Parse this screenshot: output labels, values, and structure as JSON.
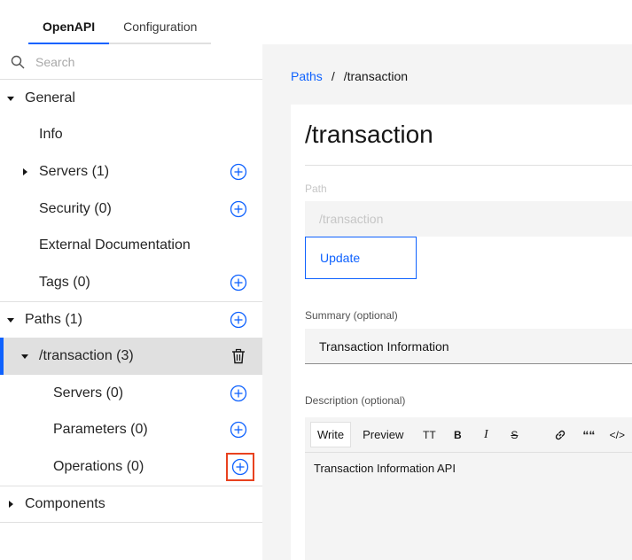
{
  "tabs": [
    {
      "label": "OpenAPI",
      "active": true
    },
    {
      "label": "Configuration",
      "active": false
    }
  ],
  "search": {
    "placeholder": "Search"
  },
  "tree": {
    "general": "General",
    "info": "Info",
    "servers": "Servers (1)",
    "security": "Security (0)",
    "external_docs": "External Documentation",
    "tags": "Tags (0)",
    "paths": "Paths (1)",
    "transaction": "/transaction (3)",
    "path_servers": "Servers (0)",
    "parameters": "Parameters (0)",
    "operations": "Operations (0)",
    "components": "Components"
  },
  "breadcrumb": {
    "root": "Paths",
    "sep": "/",
    "current": "/transaction"
  },
  "detail": {
    "title": "/transaction",
    "path_label": "Path",
    "path_value": "/transaction",
    "update_label": "Update",
    "summary_label": "Summary (optional)",
    "summary_value": "Transaction Information",
    "description_label": "Description (optional)",
    "description_value": "Transaction Information API"
  },
  "editor": {
    "write_label": "Write",
    "preview_label": "Preview",
    "heading_btn": "TT",
    "bold_btn": "B",
    "italic_btn": "I",
    "strike_btn": "S",
    "quote_btn": "““",
    "code_btn": "</>"
  },
  "colors": {
    "accent": "#0f62fe",
    "highlight": "#e8421f",
    "selected_bg": "#e0e0e0"
  }
}
